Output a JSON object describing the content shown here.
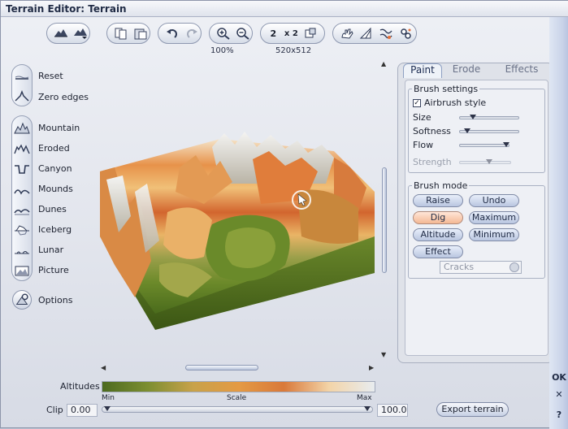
{
  "window": {
    "title": "Terrain Editor: Terrain"
  },
  "toolbar": {
    "zoom_label": "100%",
    "resolution_label": "520x512",
    "icons": [
      "terrain-view-icon",
      "terrain-view-options-icon",
      "copy-icon",
      "paste-icon",
      "undo-icon",
      "redo-icon",
      "zoom-in-icon",
      "zoom-out-icon",
      "divide-by-2-icon",
      "multiply-by-2-icon",
      "crop-icon",
      "hand-icon",
      "slope-icon",
      "filter-icon",
      "settings-icon"
    ],
    "btn_labels": {
      "div2": "2",
      "mul2": "x 2"
    }
  },
  "nav": {
    "reset": "Reset",
    "zero_edges": "Zero edges",
    "mountain": "Mountain",
    "eroded": "Eroded",
    "canyon": "Canyon",
    "mounds": "Mounds",
    "dunes": "Dunes",
    "iceberg": "Iceberg",
    "lunar": "Lunar",
    "picture": "Picture",
    "options": "Options"
  },
  "tabs": {
    "paint": "Paint",
    "erode": "Erode",
    "effects": "Effects"
  },
  "brush_settings": {
    "title": "Brush settings",
    "airbrush_label": "Airbrush style",
    "airbrush_checked": true,
    "size_label": "Size",
    "softness_label": "Softness",
    "flow_label": "Flow",
    "strength_label": "Strength",
    "size_value": 0.22,
    "softness_value": 0.13,
    "flow_value": 0.95,
    "strength_value": 0.58
  },
  "brush_mode": {
    "title": "Brush mode",
    "raise": "Raise",
    "undo": "Undo",
    "dig": "Dig",
    "maximum": "Maximum",
    "altitude": "Altitude",
    "minimum": "Minimum",
    "effect": "Effect",
    "effect_select": "Cracks",
    "active_mode": "Dig"
  },
  "bottom": {
    "altitudes_label": "Altitudes",
    "min_label": "Min",
    "scale_label": "Scale",
    "max_label": "Max",
    "clip_label": "Clip",
    "clip_min": "0.00",
    "clip_max": "100.0",
    "export_label": "Export terrain"
  },
  "side": {
    "ok": "OK",
    "close": "✕",
    "help": "?"
  },
  "colors": {
    "accent": "#7f8aa6",
    "active_mode": "#f4b894",
    "altitude_gradient": [
      "#4d6b1f",
      "#7c8e31",
      "#c8a24a",
      "#e49a44",
      "#d9793a",
      "#f3d4a8",
      "#e8ecef"
    ]
  }
}
